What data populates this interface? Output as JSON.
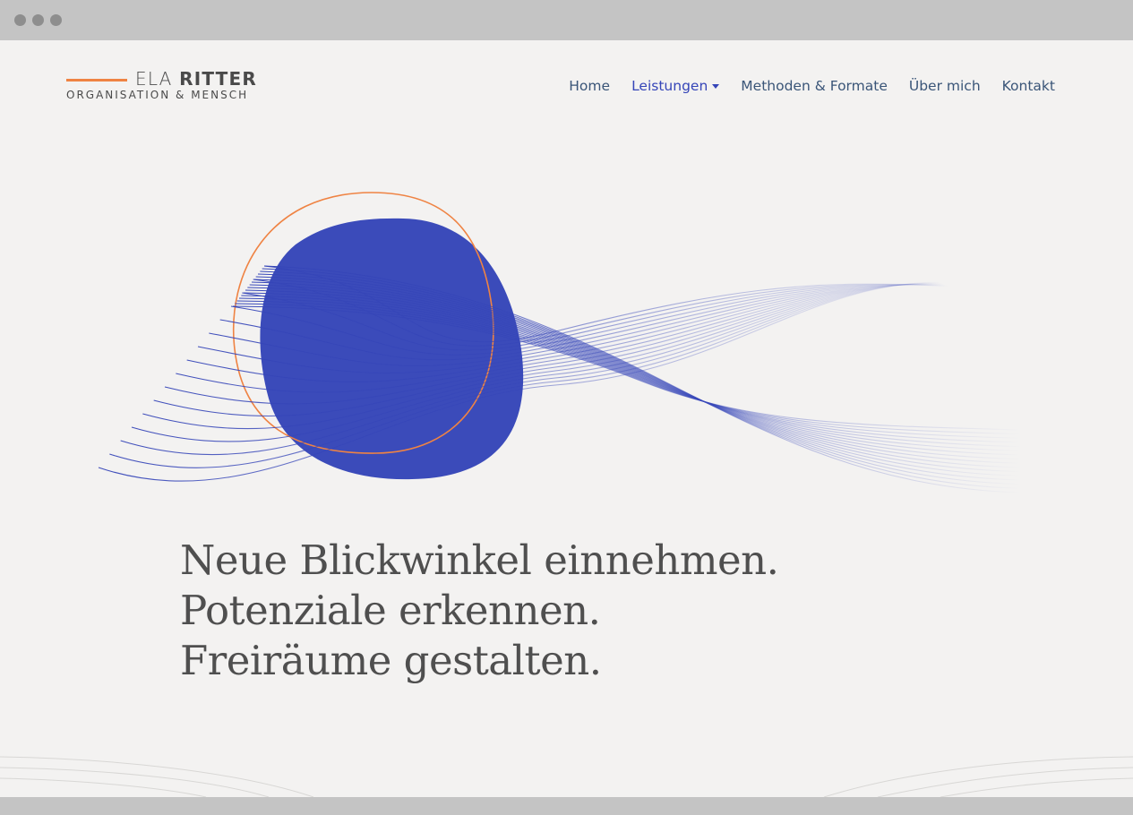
{
  "window": {
    "controls": [
      "close",
      "minimize",
      "maximize"
    ]
  },
  "brand": {
    "first_name": "ELA",
    "last_name": "RITTER",
    "tagline": "ORGANISATION & MENSCH",
    "accent_color": "#ef8343"
  },
  "nav": {
    "items": [
      {
        "label": "Home"
      },
      {
        "label": "Leistungen"
      },
      {
        "label": "Methoden & Formate"
      },
      {
        "label": "Über mich"
      },
      {
        "label": "Kontakt"
      }
    ],
    "active_color": "#3545b8",
    "color": "#3a5578"
  },
  "hero": {
    "lines": [
      "Neue Blickwinkel einnehmen.",
      "Potenziale erkennen.",
      "Freiräume gestalten."
    ],
    "blob_color": "#3545b8",
    "ring_color": "#ef8343"
  }
}
